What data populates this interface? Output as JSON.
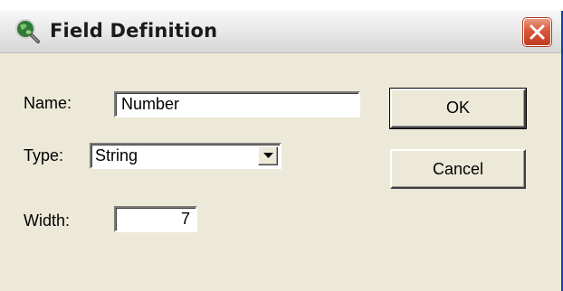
{
  "window": {
    "title": "Field Definition",
    "title_icon": "search-globe-icon",
    "close_icon": "close-icon",
    "close_color": "#d9573a"
  },
  "form": {
    "name_label": "Name:",
    "name_value": "Number",
    "type_label": "Type:",
    "type_value": "String",
    "type_dropdown_icon": "chevron-down-icon",
    "width_label": "Width:",
    "width_value": "7"
  },
  "buttons": {
    "ok_label": "OK",
    "cancel_label": "Cancel"
  }
}
